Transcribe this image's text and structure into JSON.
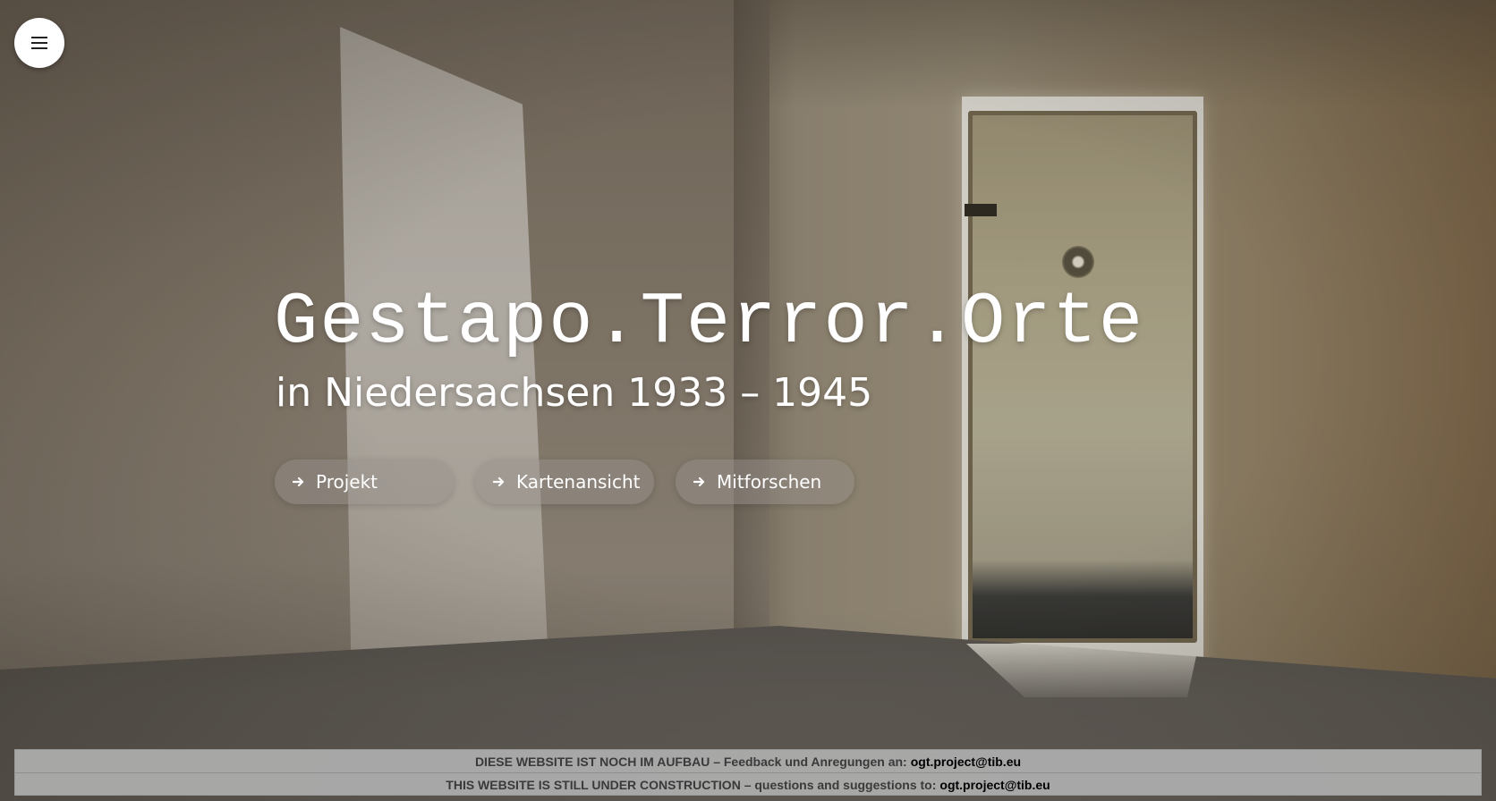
{
  "menu": {
    "icon": "menu-icon"
  },
  "hero": {
    "title": "Gestapo.Terror.Orte",
    "subtitle": "in Niedersachsen 1933 – 1945"
  },
  "nav_buttons": [
    {
      "label": "Projekt",
      "icon": "arrow-right-icon"
    },
    {
      "label": "Kartenansicht",
      "icon": "arrow-right-icon"
    },
    {
      "label": "Mitforschen",
      "icon": "arrow-right-icon"
    }
  ],
  "banner": {
    "line1_text": "DIESE WEBSITE IST NOCH IM AUFBAU – Feedback und Anregungen an:",
    "line1_email": "ogt.project@tib.eu",
    "line2_text": "THIS WEBSITE IS STILL UNDER CONSTRUCTION – questions and suggestions to:",
    "line2_email": "ogt.project@tib.eu"
  },
  "colors": {
    "text": "#ffffff",
    "button_bg": "rgba(150,145,140,0.45)",
    "banner_bg": "#afafaf"
  }
}
